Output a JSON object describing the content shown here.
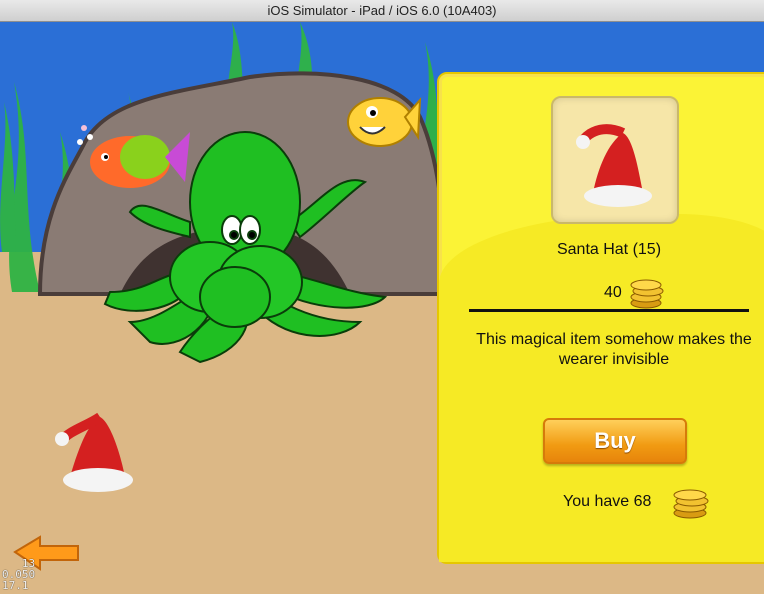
{
  "window": {
    "title": "iOS Simulator - iPad / iOS 6.0 (10A403)"
  },
  "shop": {
    "item_name": "Santa Hat (15)",
    "price": "40",
    "description": "This magical item somehow makes the wearer invisible",
    "buy_label": "Buy",
    "balance_text": "You have 68"
  },
  "debug": {
    "lines": [
      "   13",
      "0.050",
      "17.1"
    ]
  },
  "icons": [
    "santa-hat-icon",
    "coin-stack-icon",
    "back-arrow-icon"
  ],
  "colors": {
    "water": "#2b6fd6",
    "sand": "#dcb886",
    "panel": "#fbf336",
    "buy": "#f19b12",
    "octopus": "#1fbf22"
  }
}
